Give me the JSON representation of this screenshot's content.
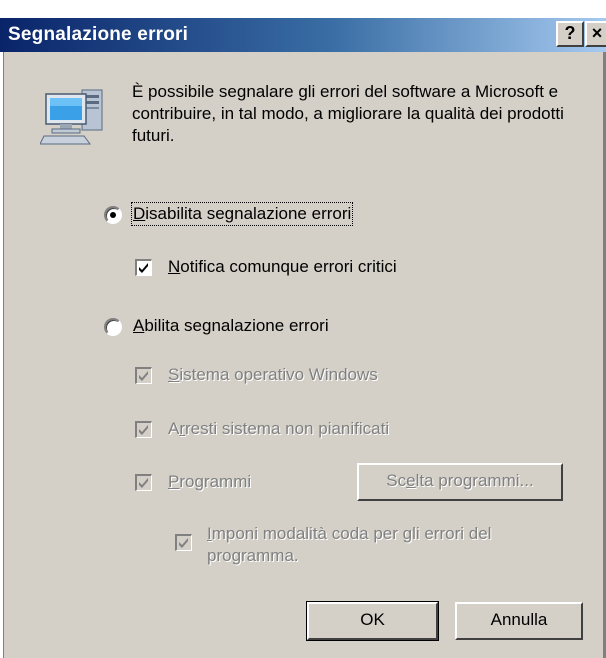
{
  "window": {
    "title": "Segnalazione errori",
    "help_button": "?",
    "close_button": "×"
  },
  "intro": {
    "icon": "computer-icon",
    "text": "È possibile segnalare gli errori del software a Microsoft e contribuire, in tal modo, a migliorare la qualità dei prodotti futuri."
  },
  "options": {
    "disable": {
      "label_first": "D",
      "label_rest": "isabilita segnalazione errori",
      "selected": true
    },
    "notify_critical": {
      "label_first": "N",
      "label_rest": "otifica comunque errori critici",
      "checked": true
    },
    "enable": {
      "label_first": "A",
      "label_rest": "bilita segnalazione errori",
      "selected": false
    },
    "windows_os": {
      "label_first": "S",
      "label_rest": "istema operativo Windows",
      "checked": true,
      "disabled": true
    },
    "unplanned_shutdowns": {
      "label_pre": "A",
      "label_u": "r",
      "label_rest": "resti sistema non pianificati",
      "checked": true,
      "disabled": true
    },
    "programs": {
      "label_first": "P",
      "label_rest": "rogrammi",
      "checked": true,
      "disabled": true
    },
    "queue_mode": {
      "label_first": "I",
      "label_line1_rest": "mponi modalità coda per gli errori del",
      "label_line2": "programma.",
      "checked": true,
      "disabled": true
    }
  },
  "buttons": {
    "choose_programs_pre": "Sc",
    "choose_programs_u": "e",
    "choose_programs_rest": "lta programmi...",
    "ok": "OK",
    "cancel": "Annulla"
  },
  "colors": {
    "title_start": "#0a246a",
    "title_end": "#a6caf0",
    "face": "#d4d0c8",
    "disabled_text": "#808080"
  }
}
